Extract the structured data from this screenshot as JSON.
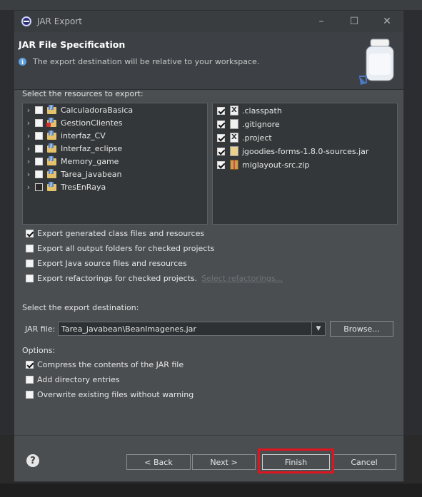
{
  "window": {
    "title": "JAR Export",
    "controls": [
      "–",
      "☐",
      "✕"
    ]
  },
  "banner": {
    "heading": "JAR File Specification",
    "info": "The export destination will be relative to your workspace."
  },
  "resources": {
    "label": "Select the resources to export:",
    "projects": [
      {
        "name": "CalculadoraBasica",
        "checked": false,
        "error": false
      },
      {
        "name": "GestionClientes",
        "checked": false,
        "error": true
      },
      {
        "name": "interfaz_CV",
        "checked": false,
        "error": false
      },
      {
        "name": "Interfaz_eclipse",
        "checked": false,
        "error": false
      },
      {
        "name": "Memory_game",
        "checked": false,
        "error": false
      },
      {
        "name": "Tarea_javabean",
        "checked": false,
        "error": false
      },
      {
        "name": "TresEnRaya",
        "checked": false,
        "error": false
      }
    ],
    "files": [
      {
        "name": ".classpath",
        "checked": true,
        "icon": "x-file-icon"
      },
      {
        "name": ".gitignore",
        "checked": true,
        "icon": "text-file-icon"
      },
      {
        "name": ".project",
        "checked": true,
        "icon": "x-file-icon"
      },
      {
        "name": "jgoodies-forms-1.8.0-sources.jar",
        "checked": true,
        "icon": "jar-file-icon"
      },
      {
        "name": "miglayout-src.zip",
        "checked": true,
        "icon": "zip-file-icon"
      }
    ]
  },
  "export_options": [
    {
      "label": "Export generated class files and resources",
      "checked": true
    },
    {
      "label": "Export all output folders for checked projects",
      "checked": false
    },
    {
      "label": "Export Java source files and resources",
      "checked": false
    },
    {
      "label": "Export refactorings for checked projects.",
      "checked": false
    }
  ],
  "select_refactorings": "Select refactorings...",
  "destination": {
    "label": "Select the export destination:",
    "jar_file_label": "JAR file:",
    "jar_file_value": "Tarea_javabean\\BeanImagenes.jar",
    "browse": "Browse..."
  },
  "options": {
    "label": "Options:",
    "items": [
      {
        "label": "Compress the contents of the JAR file",
        "checked": true
      },
      {
        "label": "Add directory entries",
        "checked": false
      },
      {
        "label": "Overwrite existing files without warning",
        "checked": false
      }
    ]
  },
  "buttons": {
    "back": "< Back",
    "next": "Next >",
    "finish": "Finish",
    "cancel": "Cancel",
    "help": "?"
  },
  "colors": {
    "highlight": "#e0141e"
  }
}
